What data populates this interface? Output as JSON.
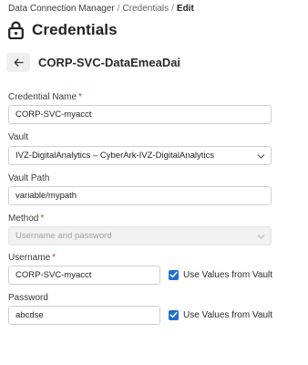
{
  "breadcrumb": {
    "items": [
      "Data Connection Manager",
      "Credentials"
    ],
    "separator": "/",
    "current": "Edit"
  },
  "header": {
    "icon": "lock-icon",
    "title": "Credentials"
  },
  "sub_header": {
    "back_icon": "arrow-left-icon",
    "title": "CORP-SVC-DataEmeaDai"
  },
  "form": {
    "credential_name": {
      "label": "Credential Name",
      "required_mark": "*",
      "value": "CORP-SVC-myacct"
    },
    "vault": {
      "label": "Vault",
      "value": "IVZ-DigitalAnalytics – CyberArk-IVZ-DigitalAnalytics"
    },
    "vault_path": {
      "label": "Vault Path",
      "value": "variable/mypath"
    },
    "method": {
      "label": "Method",
      "required_mark": "*",
      "placeholder": "Username and password",
      "disabled": true
    },
    "username": {
      "label": "Username",
      "required_mark": "*",
      "value": "CORP-SVC-myacct",
      "use_vault_label": "Use Values from Vault",
      "use_vault_checked": true
    },
    "password": {
      "label": "Password",
      "value": "abcdse",
      "use_vault_label": "Use Values from Vault",
      "use_vault_checked": true
    }
  },
  "colors": {
    "checkbox_accent": "#1f6fd1",
    "required_mark": "#c0392b",
    "input_border": "#cfcfcf",
    "disabled_bg": "#f1f1f1"
  }
}
